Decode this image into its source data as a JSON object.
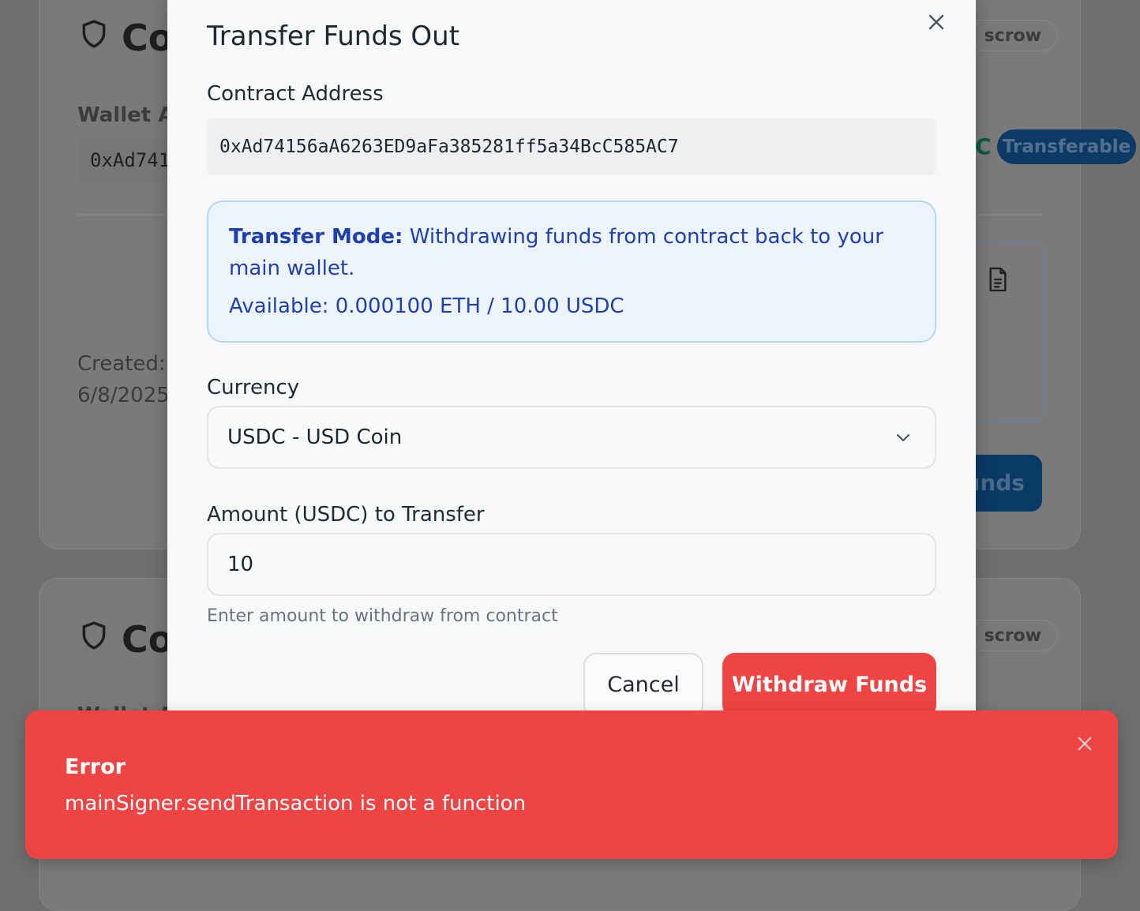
{
  "background": {
    "card_title": "Co",
    "escrow_label": "scrow",
    "wallet_label": "Wallet Ac",
    "wallet_address_partial": "0xAd741",
    "currency_partial": "C",
    "transferable_badge": "Transferable",
    "created_label": "Created:",
    "created_date": "6/8/2025",
    "funds_button_partial": "unds",
    "card2_title": "Co",
    "card2_escrow_label": "scrow",
    "card2_wallet_label": "Wallet A"
  },
  "modal": {
    "title": "Transfer Funds Out",
    "close_icon": "close-icon",
    "contract_address_label": "Contract Address",
    "contract_address": "0xAd74156aA6263ED9aFa385281ff5a34BcC585AC7",
    "info": {
      "mode_label": "Transfer Mode:",
      "mode_text": " Withdrawing funds from contract back to your main wallet.",
      "available": "Available: 0.000100 ETH / 10.00 USDC"
    },
    "currency_label": "Currency",
    "currency_selected": "USDC - USD Coin",
    "amount_label": "Amount (USDC) to Transfer",
    "amount_value": "10",
    "helper_text": "Enter amount to withdraw from contract",
    "cancel_label": "Cancel",
    "withdraw_label": "Withdraw Funds"
  },
  "toast": {
    "title": "Error",
    "message": "mainSigner.sendTransaction is not a function"
  },
  "colors": {
    "danger": "#ef4444",
    "info_text": "#1e40af",
    "info_bg": "#eef4fd",
    "info_border": "#b8d5f5",
    "overlay": "#6f6f6f"
  }
}
